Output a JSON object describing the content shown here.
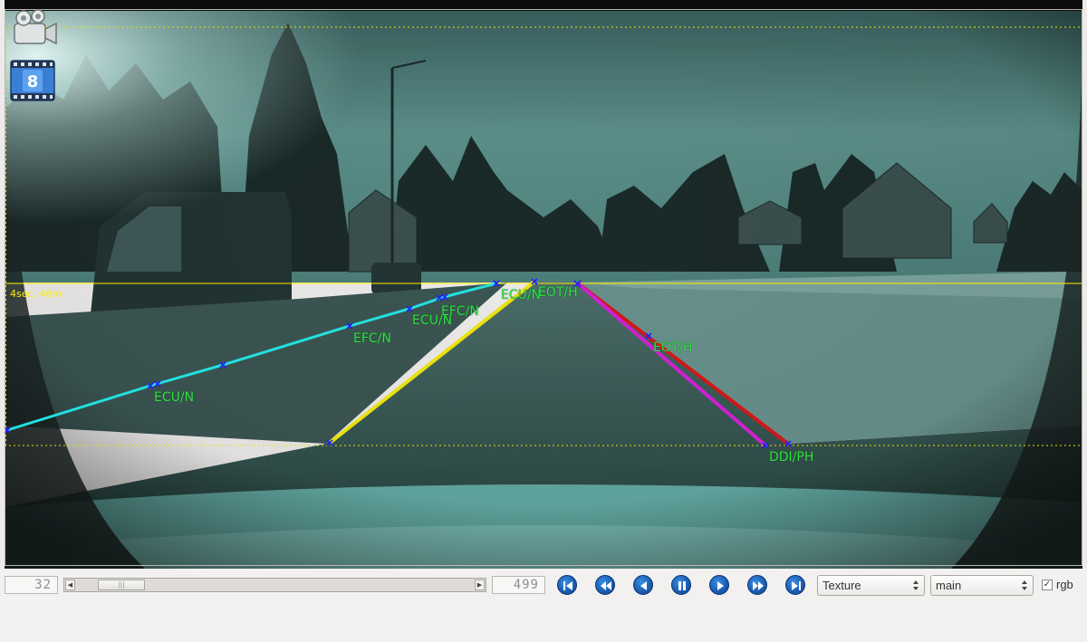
{
  "viewer": {
    "horizon_label": "4sec, 46m",
    "lane_labels": [
      {
        "id": "left-near",
        "text": "ECU/N"
      },
      {
        "id": "left-mid",
        "text": "EFC/N"
      },
      {
        "id": "left-far-1",
        "text": "ECU/N"
      },
      {
        "id": "left-far-2",
        "text": "EFC/N"
      },
      {
        "id": "center-far",
        "text": "ECU/N"
      },
      {
        "id": "right-far",
        "text": "EOT/H"
      },
      {
        "id": "right-mid",
        "text": "EOT/H"
      },
      {
        "id": "right-near",
        "text": "DDI/PH"
      }
    ],
    "line_colors": {
      "left_boundary": "#22e0e0",
      "center_line": "#e8e010",
      "right_outer": "#d01818",
      "right_inner": "#d020d0",
      "markers": "#2020ff",
      "label_text": "#2fe43c",
      "horizon": "#ffee00"
    },
    "film_badge_number": "8"
  },
  "playback": {
    "current_frame": "32",
    "total_frames": "499",
    "slider_position_fraction": 0.064,
    "buttons": {
      "first": "skip-to-start-icon",
      "rewind": "fast-rewind-icon",
      "prev": "step-back-icon",
      "pause": "pause-icon",
      "next": "step-forward-icon",
      "forward": "fast-forward-icon",
      "last": "skip-to-end-icon"
    }
  },
  "controls": {
    "mode_select": "Texture",
    "stream_select": "main",
    "rgb_label": "rgb",
    "rgb_checked": true
  }
}
